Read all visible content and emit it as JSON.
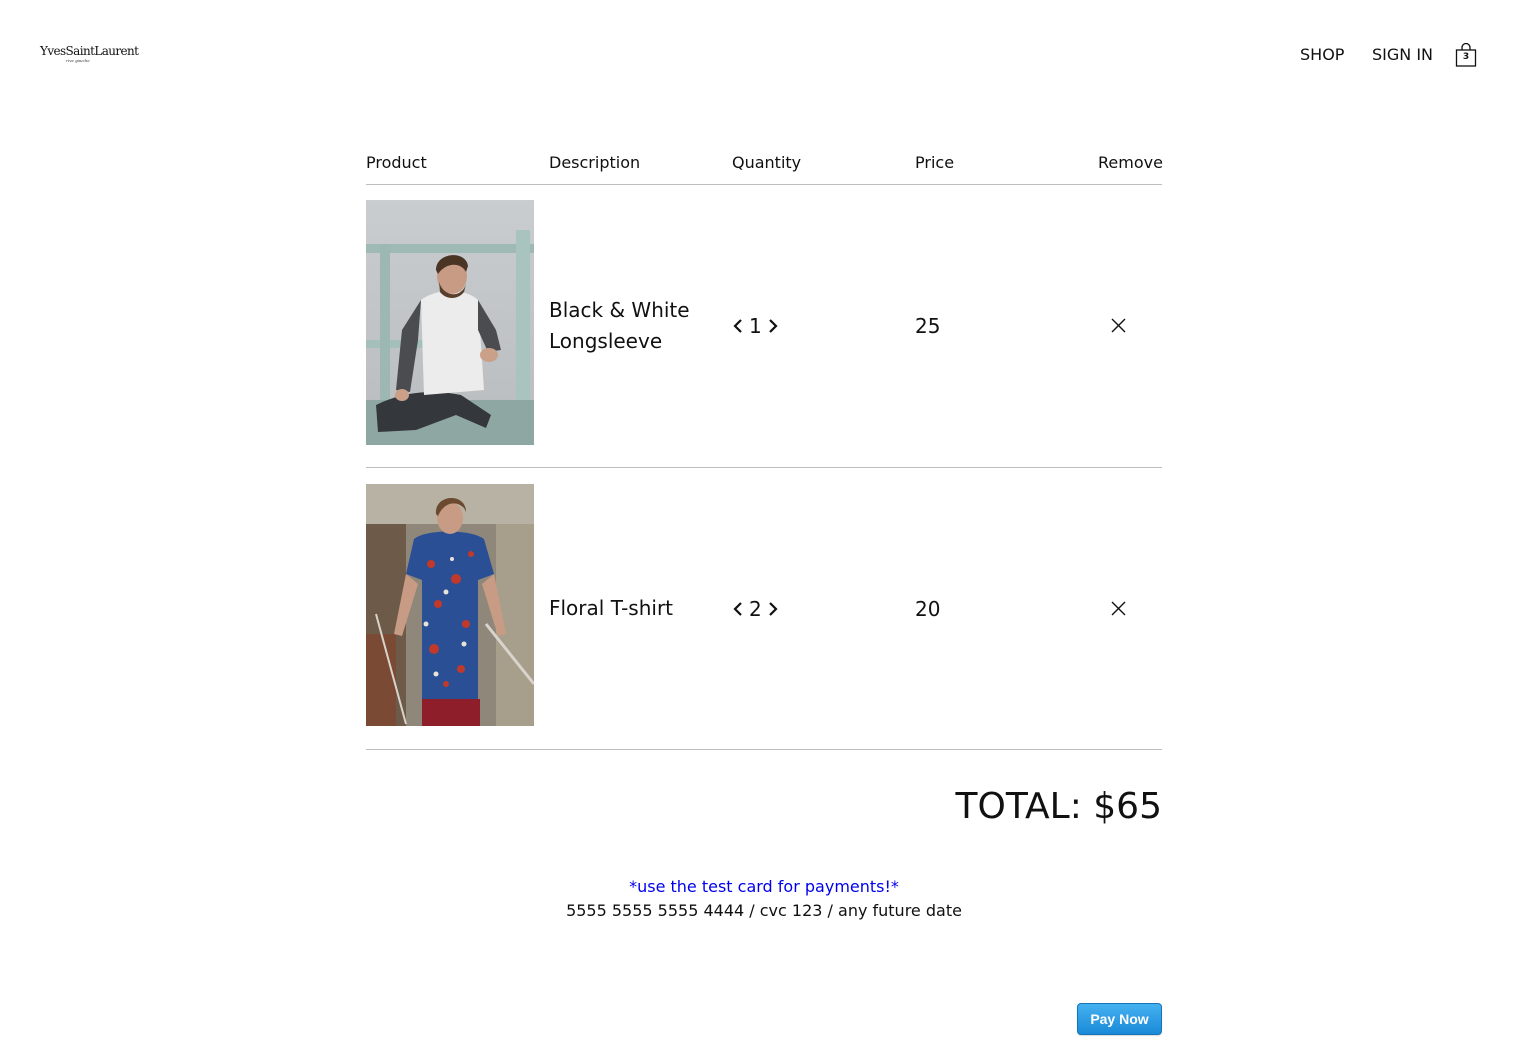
{
  "header": {
    "logo": "YvesSaintLaurent",
    "logo_sub": "rive gauche",
    "nav": {
      "shop": "SHOP",
      "sign_in": "SIGN IN"
    },
    "cart_count": "3",
    "cart_icon": "shopping-bag-icon"
  },
  "table": {
    "columns": [
      "Product",
      "Description",
      "Quantity",
      "Price",
      "Remove"
    ]
  },
  "items": [
    {
      "description": "Black & White Longsleeve",
      "quantity": "1",
      "price": "25"
    },
    {
      "description": "Floral T-shirt",
      "quantity": "2",
      "price": "20"
    }
  ],
  "icons": {
    "decrease": "chevron-left-icon",
    "increase": "chevron-right-icon",
    "remove": "close-icon"
  },
  "total": {
    "text": "TOTAL: $65"
  },
  "payment": {
    "test_note": "*use the test card for payments!*",
    "test_card": "5555 5555 5555 4444 / cvc 123 / any future date",
    "button": "Pay Now"
  },
  "colors": {
    "note_blue": "#0000ee",
    "button_blue": "#1a8ad8",
    "rule_gray": "#bdbdbd"
  }
}
